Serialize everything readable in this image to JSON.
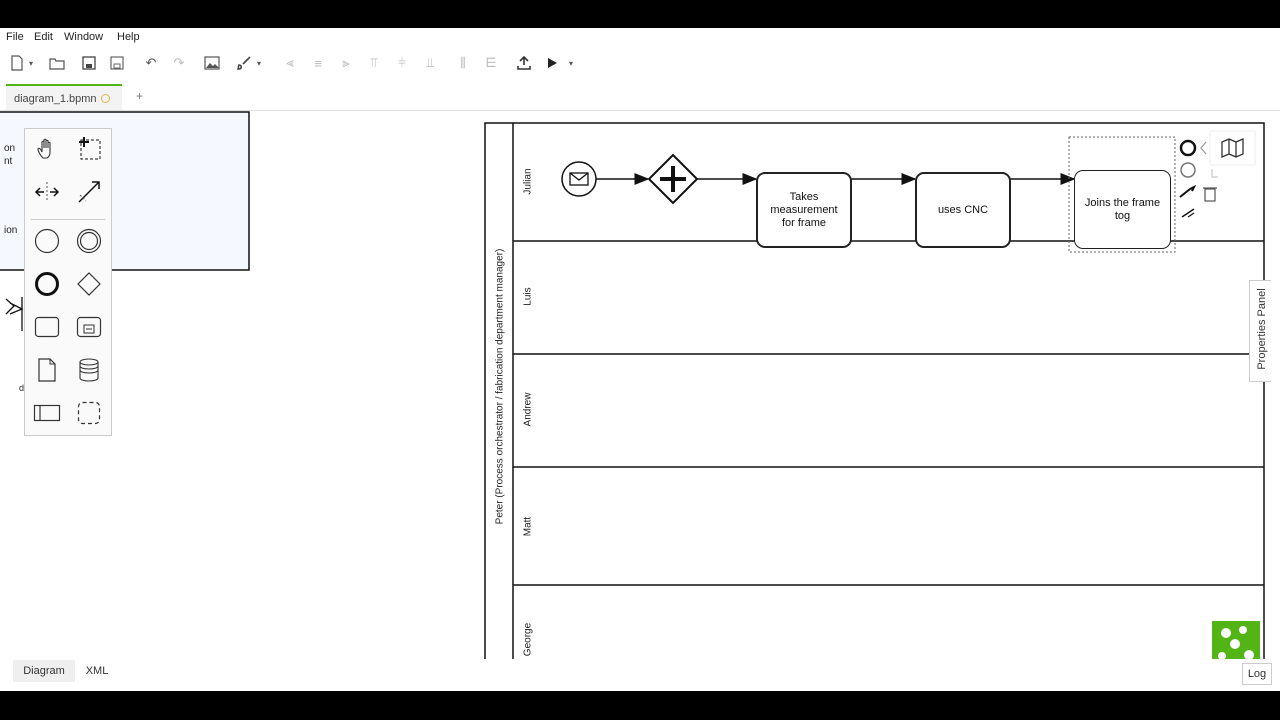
{
  "menu": [
    "File",
    "Edit",
    "Window",
    "Help"
  ],
  "tab": {
    "title": "diagram_1.bpmn",
    "add_label": "+"
  },
  "left_panel_fragments": [
    "on",
    "nt",
    "ion",
    "d"
  ],
  "pool": {
    "name": "Peter (Process orchestrator / fabrication department manager)"
  },
  "lanes": [
    "Julian",
    "Luis",
    "Andrew",
    "Matt",
    "George"
  ],
  "tasks": [
    {
      "label": "Takes measurement for frame"
    },
    {
      "label": "uses CNC"
    },
    {
      "label": "Joins the frame tog"
    }
  ],
  "properties_panel": {
    "label": "Properties Panel"
  },
  "bottom_tabs": [
    "Diagram",
    "XML"
  ],
  "log_label": "Log",
  "colors": {
    "accent": "#52b415",
    "unsaved_dot": "#e8b34a",
    "logo": "#52b415"
  }
}
